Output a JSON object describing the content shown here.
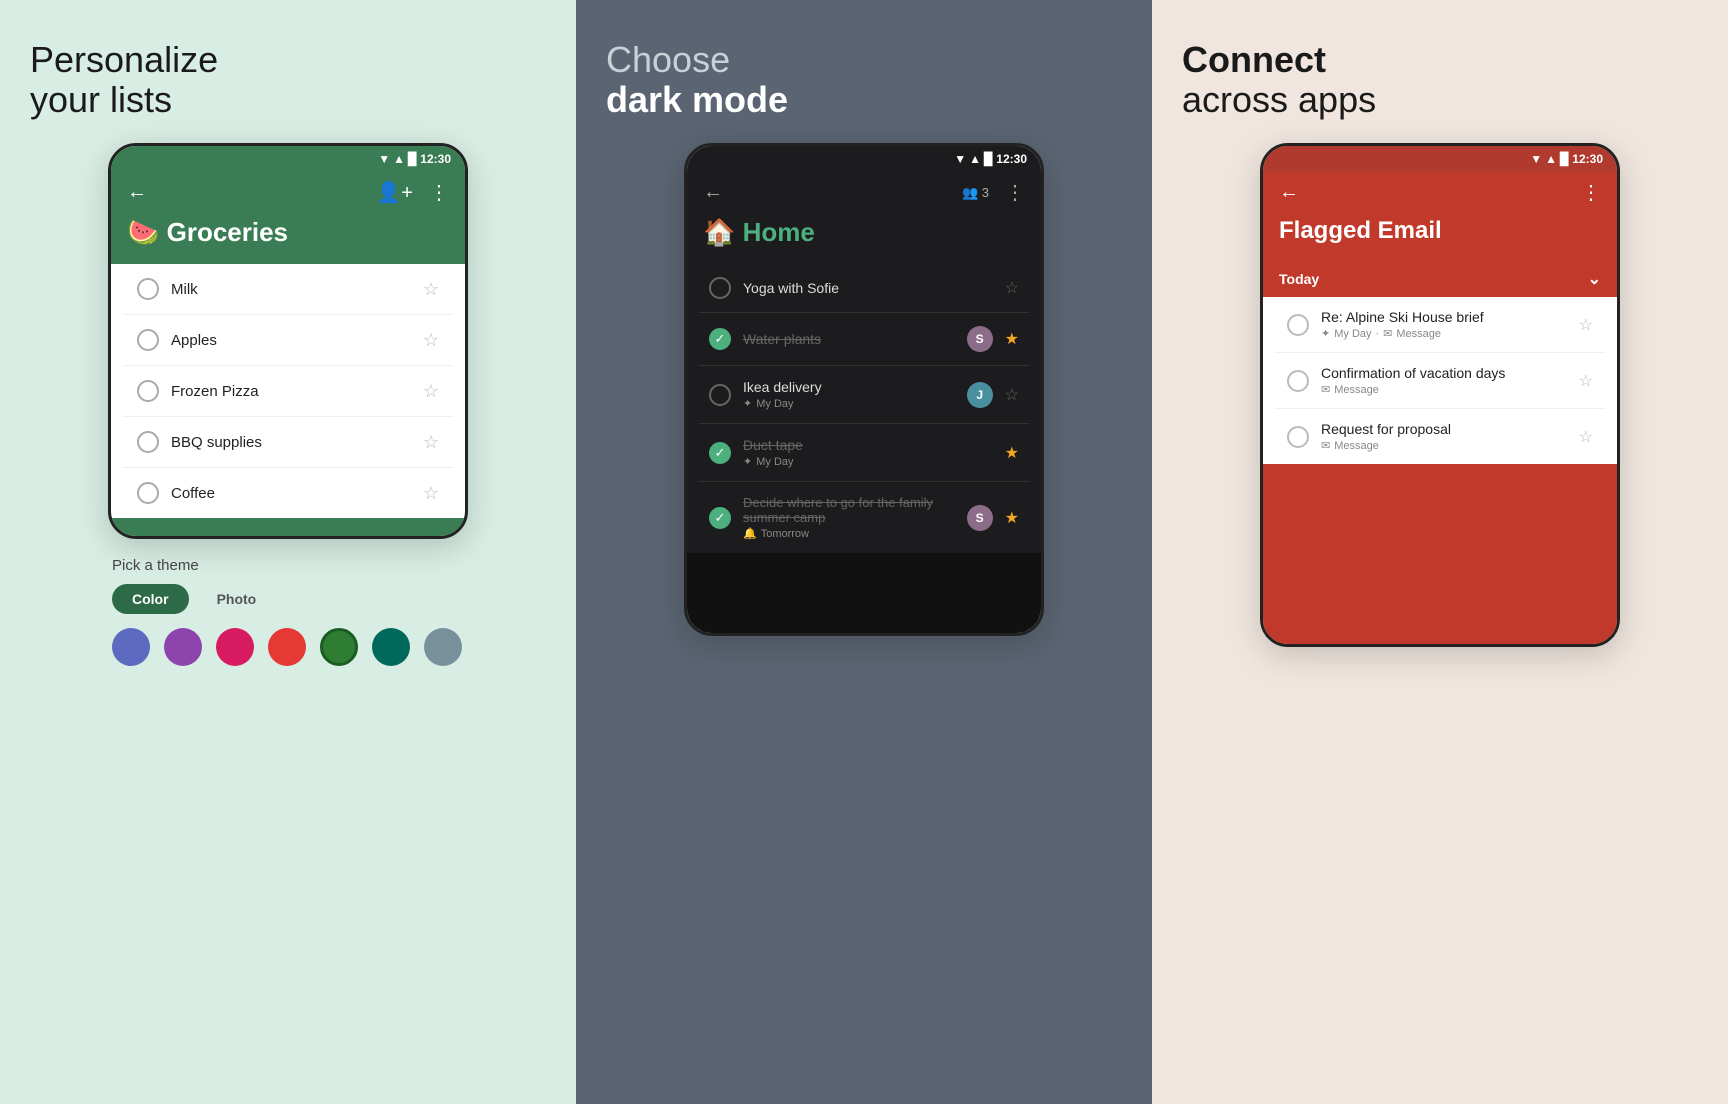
{
  "panel1": {
    "heading_bold": "Personalize",
    "heading_light": "your lists",
    "status_time": "12:30",
    "app_emoji": "🍉",
    "app_title": "Groceries",
    "items": [
      {
        "text": "Milk",
        "checked": false,
        "starred": false
      },
      {
        "text": "Apples",
        "checked": false,
        "starred": false
      },
      {
        "text": "Frozen Pizza",
        "checked": false,
        "starred": false
      },
      {
        "text": "BBQ supplies",
        "checked": false,
        "starred": false
      },
      {
        "text": "Coffee",
        "checked": false,
        "starred": false
      }
    ],
    "theme_label": "Pick a theme",
    "tab_color": "Color",
    "tab_photo": "Photo",
    "colors": [
      "#5c6bc0",
      "#8e44ad",
      "#e91e8c",
      "#e53935",
      "#2e7d32",
      "#00695c",
      "#78909c"
    ]
  },
  "panel2": {
    "heading_light": "Choose",
    "heading_bold": "dark mode",
    "status_time": "12:30",
    "app_emoji": "🏠",
    "app_title": "Home",
    "badge_count": "3",
    "items": [
      {
        "text": "Yoga with Sofie",
        "checked": false,
        "starred": false,
        "sub": "",
        "avatar": "purple"
      },
      {
        "text": "Water plants",
        "checked": true,
        "starred": true,
        "sub": "",
        "avatar": "teal"
      },
      {
        "text": "Ikea delivery",
        "checked": false,
        "starred": false,
        "sub": "My Day",
        "avatar": "teal"
      },
      {
        "text": "Duct tape",
        "checked": true,
        "starred": true,
        "sub": "My Day",
        "avatar": null
      },
      {
        "text": "Decide where to go for the family summer camp",
        "checked": true,
        "starred": true,
        "sub": "Tomorrow",
        "avatar": "purple"
      }
    ]
  },
  "panel3": {
    "heading_bold": "Connect",
    "heading_light": "across apps",
    "status_time": "12:30",
    "app_title": "Flagged Email",
    "section_label": "Today",
    "items": [
      {
        "title": "Re: Alpine Ski House brief",
        "sub1": "My Day",
        "sub2": "Message",
        "starred": false
      },
      {
        "title": "Confirmation of vacation days",
        "sub1": "Message",
        "sub2": null,
        "starred": false
      },
      {
        "title": "Request for proposal",
        "sub1": "Message",
        "sub2": null,
        "starred": false
      }
    ]
  }
}
